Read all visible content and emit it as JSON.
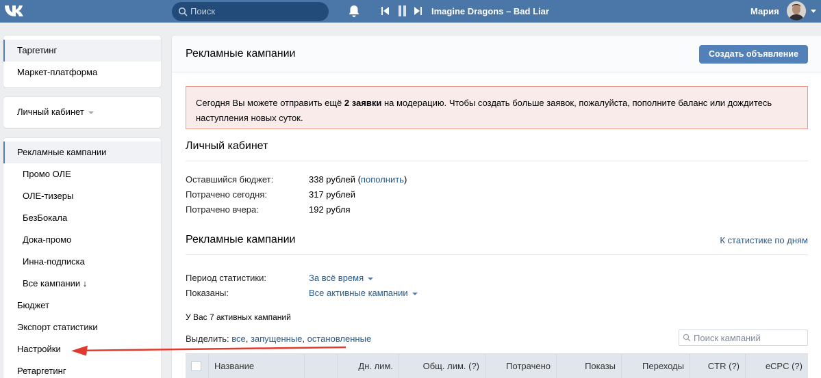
{
  "header": {
    "search_placeholder": "Поиск",
    "track": "Imagine Dragons – Bad Liar",
    "username": "Мария",
    "colors": {
      "bar": "#4a76a8",
      "search_bg": "#224b7a"
    },
    "icons": [
      "vk-logo-icon",
      "search-icon",
      "bell-icon",
      "prev-track-icon",
      "pause-icon",
      "next-track-icon",
      "chevron-down-icon"
    ]
  },
  "sidebar": {
    "group1": [
      {
        "label": "Таргетинг",
        "active": true
      },
      {
        "label": "Маркет-платформа"
      }
    ],
    "account": {
      "label": "Личный кабинет"
    },
    "group3": [
      {
        "label": "Рекламные кампании",
        "active": true
      },
      {
        "label": "Промо ОЛЕ"
      },
      {
        "label": "ОЛЕ-тизеры"
      },
      {
        "label": "БезБокала"
      },
      {
        "label": "Дока-промо"
      },
      {
        "label": "Инна-подписка"
      },
      {
        "label": "Все кампании ↓"
      },
      {
        "label": "Бюджет"
      },
      {
        "label": "Экспорт статистики"
      },
      {
        "label": "Настройки"
      },
      {
        "label": "Ретаргетинг"
      }
    ]
  },
  "main": {
    "title": "Рекламные кампании",
    "create_button": "Создать объявление",
    "warning": {
      "before": "Сегодня Вы можете отправить ещё ",
      "bold": "2 заявки",
      "after": " на модерацию. Чтобы создать больше заявок, пожалуйста, пополните баланс или дождитесь наступления новых суток."
    },
    "cabinet": {
      "title": "Личный кабинет",
      "rows": [
        {
          "key": "Оставшийся бюджет:",
          "value": "338 рублей (",
          "link": "пополнить",
          "tail": ")"
        },
        {
          "key": "Потрачено сегодня:",
          "value": "317 рублей"
        },
        {
          "key": "Потрачено вчера:",
          "value": "192 рубля"
        }
      ]
    },
    "campaigns": {
      "title": "Рекламные кампании",
      "stats_link": "К статистике по дням",
      "period_label": "Период статистики:",
      "period_value": "За всё время",
      "shown_label": "Показаны:",
      "shown_value": "Все активные кампании",
      "active_count": "У Вас 7 активных кампаний",
      "select_label": "Выделить:",
      "select_all": "все",
      "select_running": "запущенные",
      "select_stopped": "остановленные",
      "search_placeholder": "Поиск кампаний",
      "columns": [
        "Название",
        "Дн. лим.",
        "Общ. лим. (?)",
        "Потрачено",
        "Показы",
        "Переходы",
        "CTR (?)",
        "eCPC (?)"
      ]
    }
  },
  "annotation": {
    "arrow_color": "#e0392e"
  }
}
